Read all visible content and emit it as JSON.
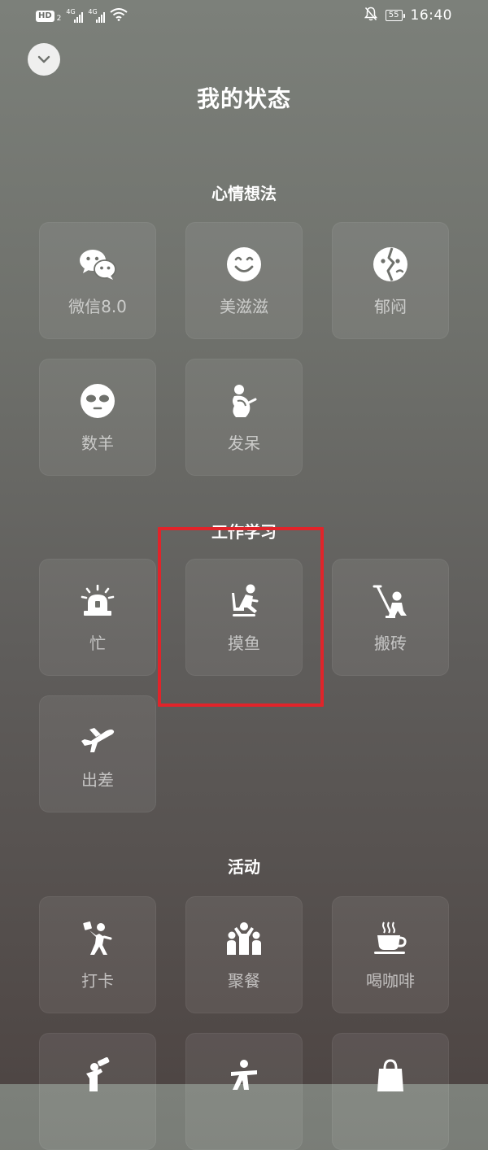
{
  "status_bar": {
    "hd": "HD",
    "sim": "2",
    "net1": "4G",
    "net2": "4G",
    "battery": "55",
    "time": "16:40"
  },
  "header": {
    "title": "我的状态"
  },
  "sections": {
    "mood": {
      "title": "心情想法",
      "items": [
        "微信8.0",
        "美滋滋",
        "郁闷",
        "数羊",
        "发呆"
      ]
    },
    "work": {
      "title": "工作学习",
      "items": [
        "忙",
        "摸鱼",
        "搬砖",
        "出差"
      ]
    },
    "activity": {
      "title": "活动",
      "items": [
        "打卡",
        "聚餐",
        "喝咖啡"
      ]
    }
  },
  "icons": {
    "collapse": "chevron-down-icon",
    "wechat": "wechat-icon",
    "smile": "smile-icon",
    "sad": "sad-face-icon",
    "sleep": "sleepy-face-icon",
    "daze": "daze-icon",
    "busy": "alarm-light-icon",
    "slack": "person-sitting-icon",
    "labor": "person-lifting-icon",
    "trip": "airplane-icon",
    "checkin": "running-person-icon",
    "dinner": "group-icon",
    "coffee": "coffee-cup-icon"
  },
  "colors": {
    "highlight": "#e1242a",
    "bg_top": "#7c807a",
    "bg_bottom": "#4e4644"
  }
}
